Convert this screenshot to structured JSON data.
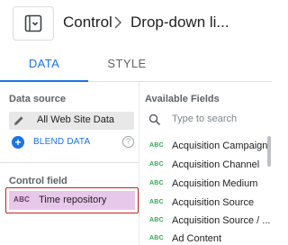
{
  "header": {
    "title": "Control",
    "chart_type": "Drop-down li...",
    "control_icon": "dropdown-control-icon",
    "separator_icon": "chevron-right-icon"
  },
  "tabs": [
    {
      "label": "DATA",
      "active": true
    },
    {
      "label": "STYLE",
      "active": false
    }
  ],
  "data_source": {
    "section_label": "Data source",
    "name": "All Web Site Data",
    "edit_icon": "pencil-icon",
    "blend_label": "BLEND DATA",
    "help_icon": "help-icon"
  },
  "control_field": {
    "section_label": "Control field",
    "type_badge": "ABC",
    "name": "Time repository"
  },
  "available_fields": {
    "section_label": "Available Fields",
    "search_placeholder": "Type to search",
    "items": [
      {
        "type": "ABC",
        "name": "Acquisition Campaign"
      },
      {
        "type": "ABC",
        "name": "Acquisition Channel"
      },
      {
        "type": "ABC",
        "name": "Acquisition Medium"
      },
      {
        "type": "ABC",
        "name": "Acquisition Source"
      },
      {
        "type": "ABC",
        "name": "Acquisition Source / ..."
      },
      {
        "type": "ABC",
        "name": "Ad Content"
      }
    ]
  },
  "colors": {
    "accent": "#1a73e8",
    "selected_border": "#c5221f",
    "selected_fill": "#e8c8ea",
    "dimension_green": "#34a853"
  }
}
